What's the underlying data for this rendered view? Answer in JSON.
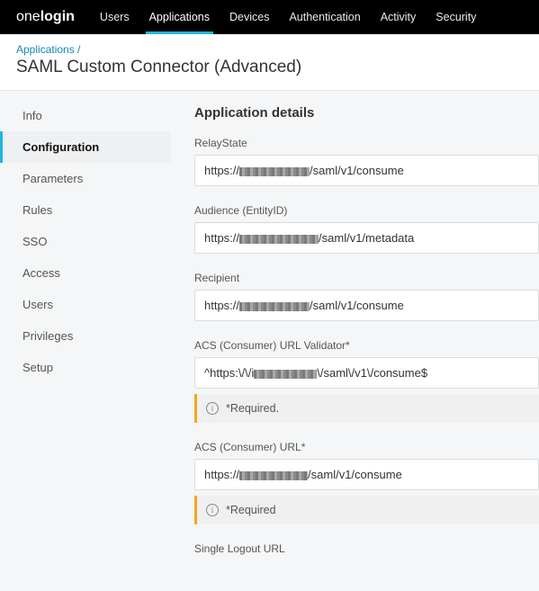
{
  "logo": {
    "part1": "one",
    "part2": "login"
  },
  "topnav": {
    "items": [
      "Users",
      "Applications",
      "Devices",
      "Authentication",
      "Activity",
      "Security"
    ],
    "activeIndex": 1
  },
  "breadcrumb": {
    "root": "Applications",
    "sep": " /"
  },
  "pageTitle": "SAML Custom Connector (Advanced)",
  "sidebar": {
    "items": [
      "Info",
      "Configuration",
      "Parameters",
      "Rules",
      "SSO",
      "Access",
      "Users",
      "Privileges",
      "Setup"
    ],
    "activeIndex": 1
  },
  "sectionTitle": "Application details",
  "fields": {
    "relayState": {
      "label": "RelayState",
      "prefix": "https://",
      "suffix": "/saml/v1/consume"
    },
    "audience": {
      "label": "Audience (EntityID)",
      "prefix": "https://",
      "suffix": "/saml/v1/metadata"
    },
    "recipient": {
      "label": "Recipient",
      "prefix": "https://",
      "suffix": "/saml/v1/consume"
    },
    "acsValidator": {
      "label": "ACS (Consumer) URL Validator*",
      "prefix": "^https:\\/\\/i",
      "suffix": "\\/saml\\/v1\\/consume$",
      "notice": "*Required."
    },
    "acsUrl": {
      "label": "ACS (Consumer) URL*",
      "prefix": "https://",
      "suffix": "/saml/v1/consume",
      "notice": "*Required"
    },
    "slo": {
      "label": "Single Logout URL"
    }
  }
}
